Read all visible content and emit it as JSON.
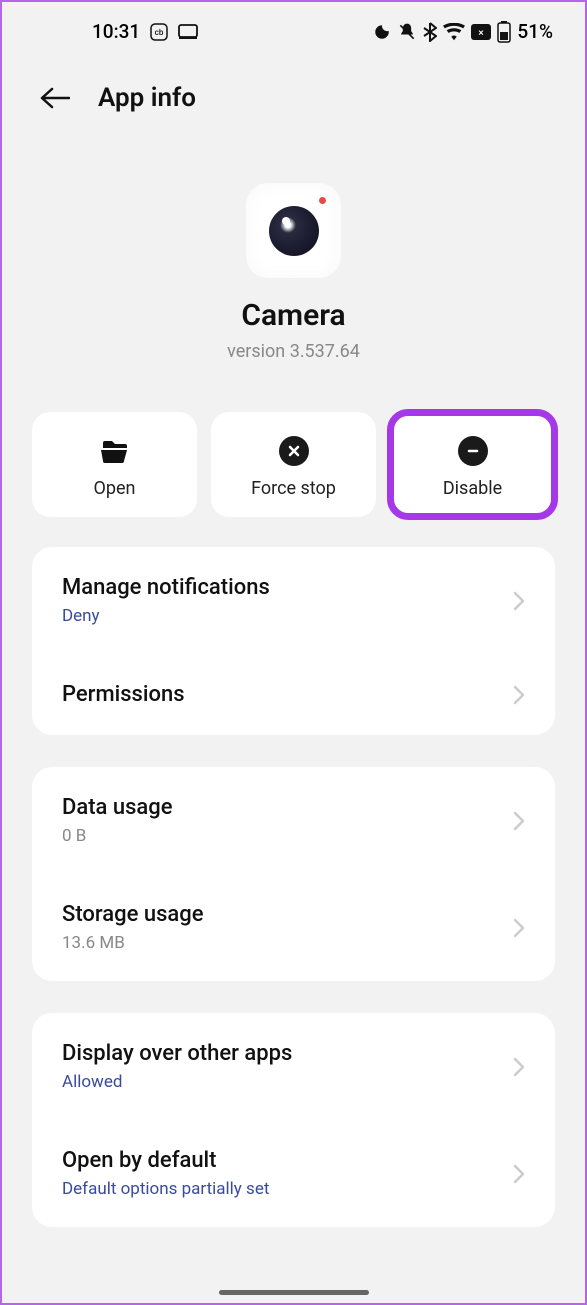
{
  "status": {
    "time": "10:31",
    "battery": "51%"
  },
  "header": {
    "title": "App info"
  },
  "app": {
    "name": "Camera",
    "version": "version 3.537.64"
  },
  "actions": {
    "open": "Open",
    "force_stop": "Force stop",
    "disable": "Disable"
  },
  "sections": [
    {
      "rows": [
        {
          "title": "Manage notifications",
          "sub": "Deny",
          "sub_style": "link"
        },
        {
          "title": "Permissions",
          "sub": null
        }
      ]
    },
    {
      "rows": [
        {
          "title": "Data usage",
          "sub": "0 B",
          "sub_style": "gray"
        },
        {
          "title": "Storage usage",
          "sub": "13.6 MB",
          "sub_style": "gray"
        }
      ]
    },
    {
      "rows": [
        {
          "title": "Display over other apps",
          "sub": "Allowed",
          "sub_style": "link"
        },
        {
          "title": "Open by default",
          "sub": "Default options partially set",
          "sub_style": "link"
        }
      ]
    }
  ]
}
